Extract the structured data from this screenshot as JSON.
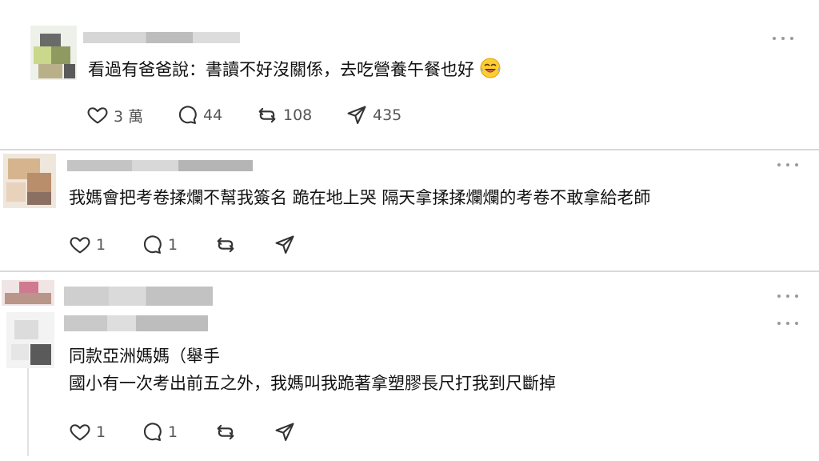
{
  "posts": [
    {
      "text_lines": [
        "看過有爸爸說：書讀不好沒關係，去吃營養午餐也好"
      ],
      "emoji": "laughing-tears-emoji",
      "actions": {
        "like_count": "3 萬",
        "reply_count": "44",
        "repost_count": "108",
        "share_count": "435"
      }
    },
    {
      "text_lines": [
        "我媽會把考卷揉爛不幫我簽名 跪在地上哭 隔天拿揉揉爛爛的考卷不敢拿給老師"
      ],
      "actions": {
        "like_count": "1",
        "reply_count": "1",
        "repost_count": "",
        "share_count": ""
      }
    },
    {
      "text_lines": [],
      "actions": {}
    },
    {
      "text_lines": [
        "同款亞洲媽媽（舉手",
        "國小有一次考出前五之外，我媽叫我跪著拿塑膠長尺打我到尺斷掉"
      ],
      "actions": {
        "like_count": "1",
        "reply_count": "1",
        "repost_count": "",
        "share_count": ""
      }
    }
  ],
  "icons": {
    "like": "heart-icon",
    "reply": "comment-icon",
    "repost": "repost-icon",
    "share": "send-icon",
    "more": "more-options-icon"
  },
  "colors": {
    "icon": "#333333",
    "count": "#555555",
    "divider": "#d9d9d9",
    "more_dots": "#9a9a9a"
  }
}
